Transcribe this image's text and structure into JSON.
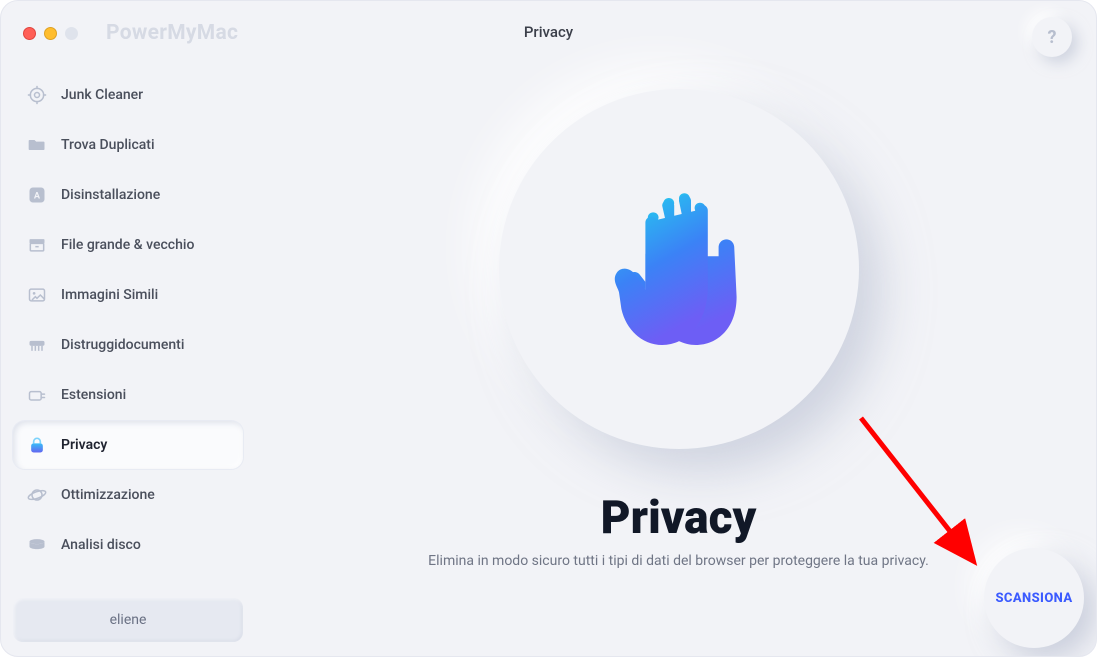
{
  "app": {
    "name": "PowerMyMac"
  },
  "header": {
    "page_title": "Privacy",
    "help_symbol": "?"
  },
  "sidebar": {
    "items": [
      {
        "id": "junk-cleaner",
        "label": "Junk Cleaner"
      },
      {
        "id": "find-duplicates",
        "label": "Trova Duplicati"
      },
      {
        "id": "uninstaller",
        "label": "Disinstallazione"
      },
      {
        "id": "large-old-files",
        "label": "File grande & vecchio"
      },
      {
        "id": "similar-images",
        "label": "Immagini Simili"
      },
      {
        "id": "shredder",
        "label": "Distruggidocumenti"
      },
      {
        "id": "extensions",
        "label": "Estensioni"
      },
      {
        "id": "privacy",
        "label": "Privacy"
      },
      {
        "id": "optimization",
        "label": "Ottimizzazione"
      },
      {
        "id": "disk-analysis",
        "label": "Analisi disco"
      }
    ],
    "active_index": 7,
    "user_label": "eliene"
  },
  "main": {
    "title": "Privacy",
    "subtitle": "Elimina in modo sicuro tutti i tipi di dati del browser per proteggere la tua privacy.",
    "scan_label": "SCANSIONA"
  },
  "colors": {
    "accent_blue": "#3b5bff",
    "hand_top": "#22d3ee",
    "hand_bottom": "#6366f1",
    "annotation_red": "#ff0000"
  }
}
